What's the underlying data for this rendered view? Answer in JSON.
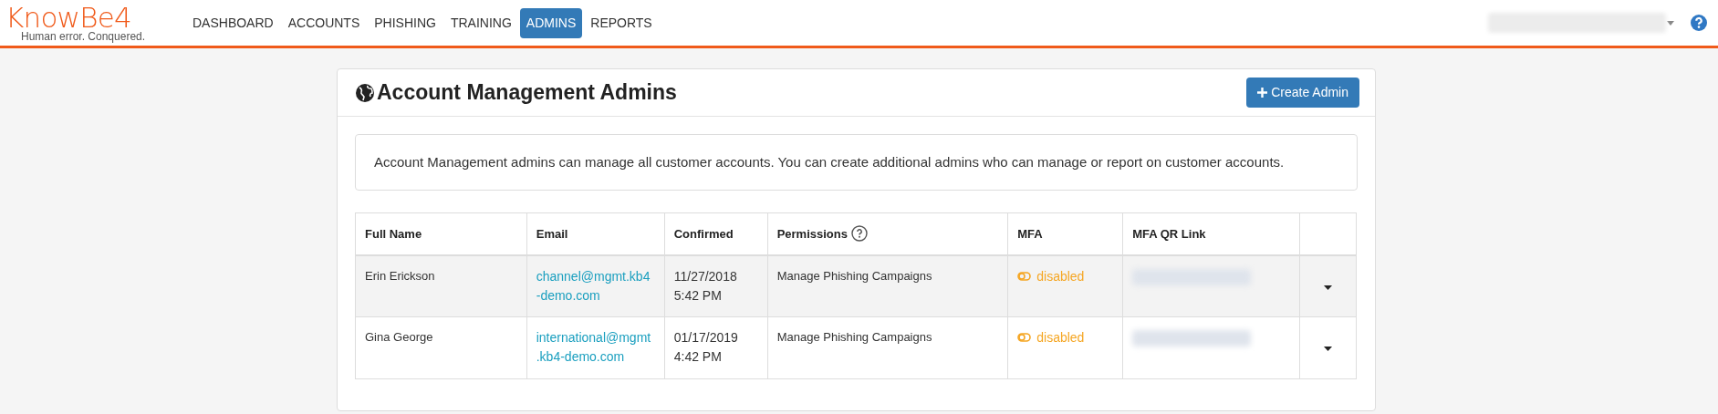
{
  "logo": {
    "name": "KnowBe4",
    "tagline": "Human error. Conquered."
  },
  "nav": [
    {
      "label": "DASHBOARD",
      "selected": false
    },
    {
      "label": "ACCOUNTS",
      "selected": false
    },
    {
      "label": "PHISHING",
      "selected": false
    },
    {
      "label": "TRAINING",
      "selected": false
    },
    {
      "label": "ADMINS",
      "selected": true
    },
    {
      "label": "REPORTS",
      "selected": false
    }
  ],
  "page": {
    "title": "Account Management Admins",
    "create_button": "Create Admin",
    "info": "Account Management admins can manage all customer accounts. You can create additional admins who can manage or report on customer accounts."
  },
  "table": {
    "columns": [
      "Full Name",
      "Email",
      "Confirmed",
      "Permissions",
      "MFA",
      "MFA QR Link"
    ],
    "rows": [
      {
        "name": "Erin Erickson",
        "email_lines": [
          "channel@mgmt.kb4",
          "-demo.com"
        ],
        "confirmed_date": "11/27/2018",
        "confirmed_time": "5:42 PM",
        "permissions": "Manage Phishing Campaigns",
        "mfa": "disabled",
        "mfa_enabled": false
      },
      {
        "name": "Gina George",
        "email_lines": [
          "international@mgmt",
          ".kb4-demo.com"
        ],
        "confirmed_date": "01/17/2019",
        "confirmed_time": "4:42 PM",
        "permissions": "Manage Phishing Campaigns",
        "mfa": "disabled",
        "mfa_enabled": false
      }
    ]
  }
}
